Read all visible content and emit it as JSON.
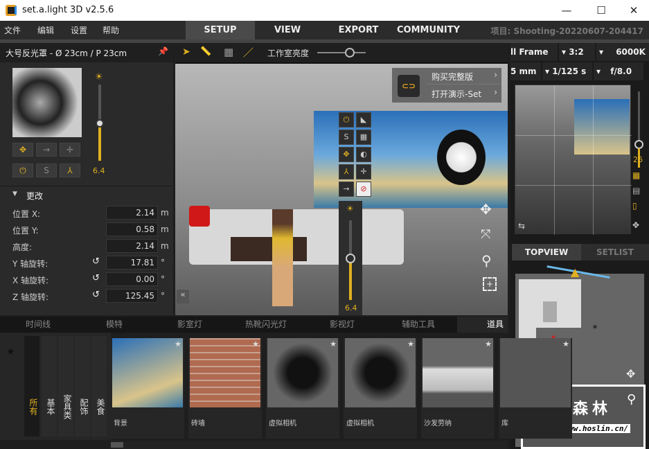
{
  "window": {
    "title": "set.a.light 3D v2.5.6",
    "minimize": "—",
    "maximize": "☐",
    "close": "✕"
  },
  "menu": [
    "文件",
    "编辑",
    "设置",
    "帮助"
  ],
  "main_tabs": [
    "SETUP",
    "VIEW",
    "EXPORT",
    "COMMUNITY"
  ],
  "project": "项目: Shooting-20220607-204417",
  "left_panel": {
    "title": "大号反光罩 - Ø 23cm / P 23cm",
    "power_value": "6.4",
    "buttons_row2": [
      "⏻",
      "S",
      "⅄"
    ],
    "section": "更改",
    "fields": [
      {
        "label": "位置 X:",
        "value": "2.14",
        "unit": "m",
        "reset": false
      },
      {
        "label": "位置 Y:",
        "value": "0.58",
        "unit": "m",
        "reset": false
      },
      {
        "label": "高度:",
        "value": "2.14",
        "unit": "m",
        "reset": false
      },
      {
        "label": "Y 轴旋转:",
        "value": "17.81",
        "unit": "°",
        "reset": true
      },
      {
        "label": "X 轴旋转:",
        "value": "0.00",
        "unit": "°",
        "reset": true
      },
      {
        "label": "Z 轴旋转:",
        "value": "125.45",
        "unit": "°",
        "reset": true
      }
    ]
  },
  "viewport": {
    "brightness_label": "工作室亮度",
    "brightness_level": 0.6,
    "promo": [
      "购买完整版",
      "打开演示-Set"
    ],
    "light_power": "6.4",
    "light_buttons": [
      "⏻",
      "S",
      "✥",
      "⅄",
      "⚲"
    ]
  },
  "camera": {
    "sensor": "ll Frame",
    "ratio": "3:2",
    "temp": "6000K",
    "focal": "5 mm",
    "shutter": "1/125 s",
    "aperture": "f/8.0",
    "iso": "26"
  },
  "topview_tabs": [
    "TOPVIEW",
    "SETLIST"
  ],
  "watermark": {
    "text": "红森林",
    "url": "http://www.hoslin.cn/"
  },
  "bottom_tabs": [
    "时间线",
    "模特",
    "影室灯",
    "热靴闪光灯",
    "影视灯",
    "辅助工具",
    "道具"
  ],
  "categories": [
    "所有",
    "基本",
    "家具类",
    "配饰",
    "美食"
  ],
  "items": [
    "背景",
    "砖墙",
    "虚拟相机",
    "虚拟相机",
    "沙发劳纳",
    "库"
  ],
  "colors": {
    "accent": "#e0b020"
  }
}
